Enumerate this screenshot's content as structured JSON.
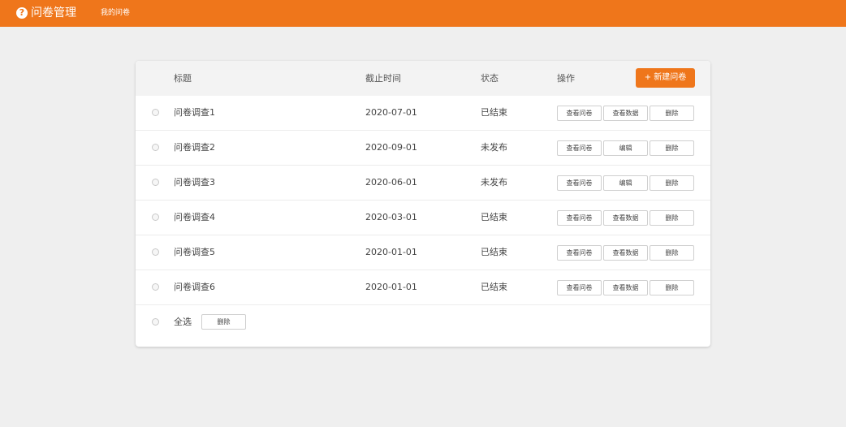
{
  "topbar": {
    "brand_icon": "?",
    "brand_title": "问卷管理",
    "nav_link": "我的问卷"
  },
  "table": {
    "headers": {
      "title": "标题",
      "deadline": "截止时间",
      "status": "状态",
      "actions": "操作"
    },
    "new_button": "+ 新建问卷",
    "rows": [
      {
        "title": "问卷调查1",
        "deadline": "2020-07-01",
        "status": "已结束",
        "btn1": "查看问卷",
        "btn2": "查看数据",
        "btn3": "删除"
      },
      {
        "title": "问卷调查2",
        "deadline": "2020-09-01",
        "status": "未发布",
        "btn1": "查看问卷",
        "btn2": "编辑",
        "btn3": "删除"
      },
      {
        "title": "问卷调查3",
        "deadline": "2020-06-01",
        "status": "未发布",
        "btn1": "查看问卷",
        "btn2": "编辑",
        "btn3": "删除"
      },
      {
        "title": "问卷调查4",
        "deadline": "2020-03-01",
        "status": "已结束",
        "btn1": "查看问卷",
        "btn2": "查看数据",
        "btn3": "删除"
      },
      {
        "title": "问卷调查5",
        "deadline": "2020-01-01",
        "status": "已结束",
        "btn1": "查看问卷",
        "btn2": "查看数据",
        "btn3": "删除"
      },
      {
        "title": "问卷调查6",
        "deadline": "2020-01-01",
        "status": "已结束",
        "btn1": "查看问卷",
        "btn2": "查看数据",
        "btn3": "删除"
      }
    ],
    "footer": {
      "select_all": "全选",
      "delete_button": "删除"
    }
  },
  "colors": {
    "accent": "#ef761b",
    "background": "#efefef"
  }
}
